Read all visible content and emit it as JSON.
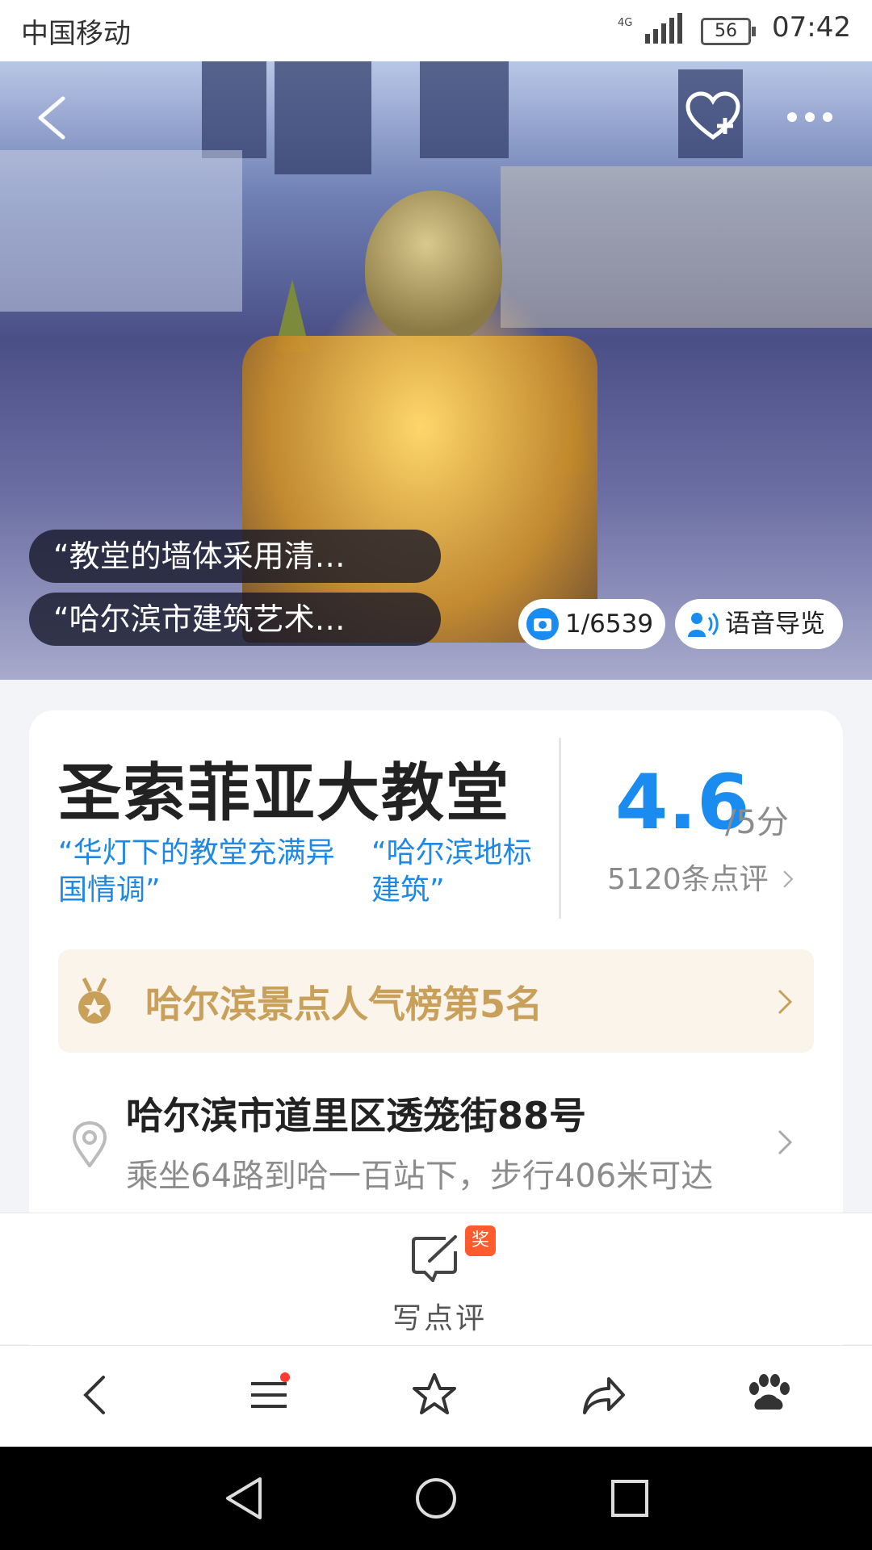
{
  "status_bar": {
    "carrier": "中国移动",
    "network": "4G",
    "battery": "56",
    "time": "07:42"
  },
  "hero": {
    "quotes": [
      "“教堂的墙体采用清…",
      "“哈尔滨市建筑艺术…"
    ],
    "photo_counter": "1/6539",
    "audio_guide_label": "语音导览"
  },
  "attraction": {
    "name": "圣索菲亚大教堂",
    "tags": [
      "“华灯下的教堂充满异国情调”",
      "“哈尔滨地标建筑”"
    ],
    "tag1_line1": "“华灯下的教堂充满异",
    "tag1_line2": "国情调”",
    "tag2_line1": "“哈尔滨地标",
    "tag2_line2": "建筑”",
    "rating": "4.6",
    "rating_unit": "/5分",
    "review_count": "5120条点评",
    "ranking": "哈尔滨景点人气榜第5名",
    "address": "哈尔滨市道里区透笼街88号",
    "route": "乘坐64路到哈一百站下，步行406米可达"
  },
  "actions": {
    "write_review": "写点评",
    "award_badge": "奖"
  },
  "colors": {
    "accent": "#1a8cf0",
    "tag": "#1e88e5",
    "rank_text": "#c9a05a",
    "badge": "#ff5b2e"
  }
}
